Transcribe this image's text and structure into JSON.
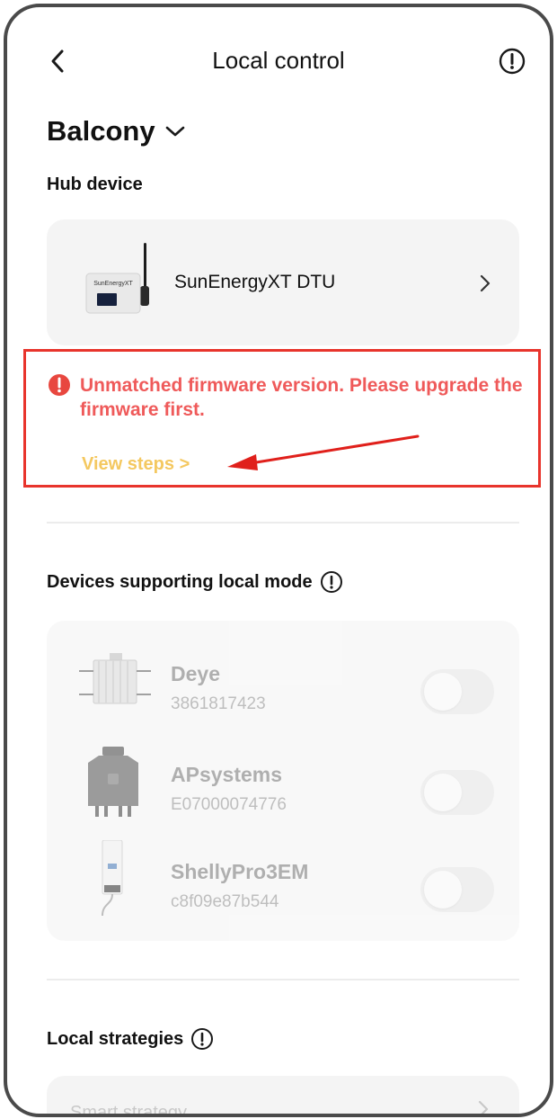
{
  "header": {
    "title": "Local control",
    "back_icon": "chevron-left-icon",
    "info_icon": "info-circle-icon"
  },
  "site": {
    "name": "Balcony",
    "dropdown_icon": "chevron-down-icon"
  },
  "hub": {
    "section_title": "Hub device",
    "device_name": "SunEnergyXT DTU",
    "device_image_text": "SunEnergyXT",
    "chevron_icon": "chevron-right-icon"
  },
  "warning": {
    "icon": "error-circle-icon",
    "message": "Unmatched firmware version. Please upgrade the firmware first.",
    "link_label": "View steps >",
    "annotation": "red-arrow-icon",
    "colors": {
      "border": "#e8342c",
      "text": "#ef5a5a",
      "link": "#f4c860"
    }
  },
  "local_devices": {
    "section_title": "Devices supporting local mode",
    "info_icon": "info-circle-icon",
    "items": [
      {
        "name": "Deye",
        "serial": "3861817423",
        "icon": "microinverter-icon",
        "enabled": false
      },
      {
        "name": "APsystems",
        "serial": "E07000074776",
        "icon": "microinverter-icon",
        "enabled": false
      },
      {
        "name": "ShellyPro3EM",
        "serial": "c8f09e87b544",
        "icon": "energy-meter-icon",
        "enabled": false
      }
    ]
  },
  "strategies": {
    "section_title": "Local strategies",
    "info_icon": "info-circle-icon",
    "first_item": "Smart strategy",
    "chevron_icon": "chevron-right-icon"
  }
}
